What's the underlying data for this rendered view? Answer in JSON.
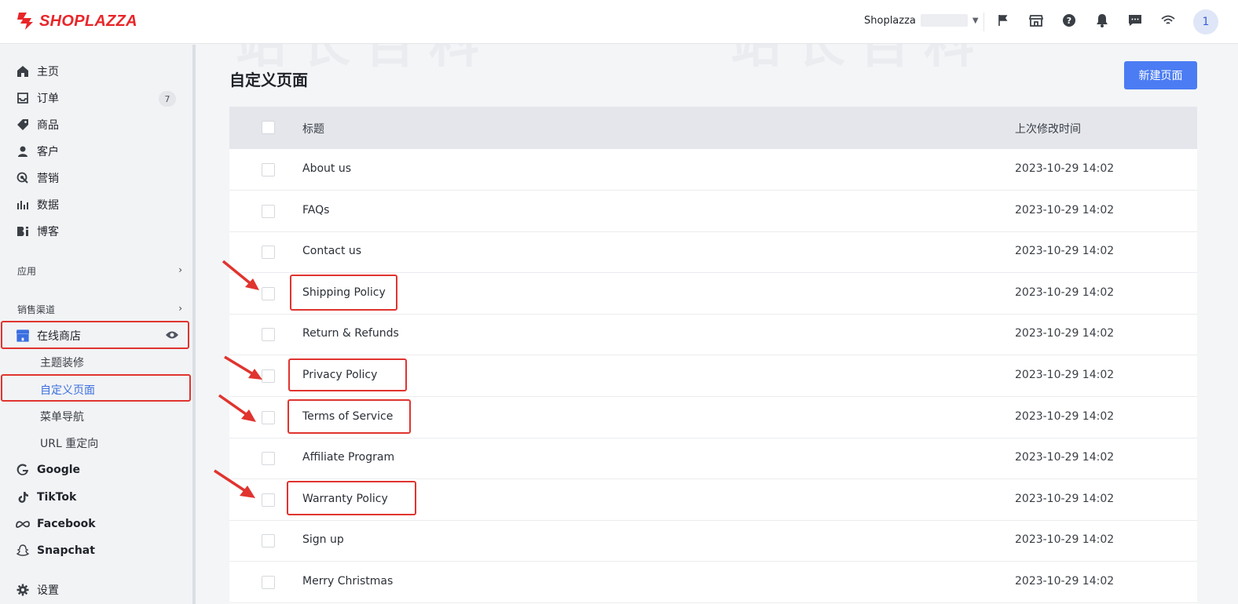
{
  "brand": {
    "name": "SHOPLAZZA",
    "color": "#e8262a"
  },
  "header": {
    "store_name": "Shoplazza",
    "avatar_initial": "1",
    "icons": [
      "flag-icon",
      "store-icon",
      "help-icon",
      "bell-icon",
      "message-icon",
      "wifi-icon"
    ]
  },
  "sidebar": {
    "items": [
      {
        "label": "主页",
        "icon": "home-icon"
      },
      {
        "label": "订单",
        "icon": "inbox-icon",
        "badge": "7"
      },
      {
        "label": "商品",
        "icon": "tag-icon"
      },
      {
        "label": "客户",
        "icon": "person-icon"
      },
      {
        "label": "营销",
        "icon": "marketing-icon"
      },
      {
        "label": "数据",
        "icon": "bar-chart-icon"
      },
      {
        "label": "博客",
        "icon": "blog-icon"
      }
    ],
    "apps_label": "应用",
    "channels_label": "销售渠道",
    "online_store": {
      "label": "在线商店",
      "icon": "store-icon"
    },
    "sub_items": [
      "主题装修",
      "自定义页面",
      "菜单导航",
      "URL 重定向"
    ],
    "channels": [
      {
        "label": "Google",
        "icon": "google-icon"
      },
      {
        "label": "TikTok",
        "icon": "tiktok-icon"
      },
      {
        "label": "Facebook",
        "icon": "meta-icon"
      },
      {
        "label": "Snapchat",
        "icon": "snapchat-icon"
      }
    ],
    "settings_label": "设置"
  },
  "main": {
    "title": "自定义页面",
    "new_button": "新建页面",
    "columns": {
      "title": "标题",
      "modified": "上次修改时间"
    },
    "rows": [
      {
        "title": "About us",
        "modified": "2023-10-29 14:02"
      },
      {
        "title": "FAQs",
        "modified": "2023-10-29 14:02"
      },
      {
        "title": "Contact us",
        "modified": "2023-10-29 14:02"
      },
      {
        "title": "Shipping Policy",
        "modified": "2023-10-29 14:02"
      },
      {
        "title": "Return & Refunds",
        "modified": "2023-10-29 14:02"
      },
      {
        "title": "Privacy Policy",
        "modified": "2023-10-29 14:02"
      },
      {
        "title": "Terms of Service",
        "modified": "2023-10-29 14:02"
      },
      {
        "title": "Affiliate Program",
        "modified": "2023-10-29 14:02"
      },
      {
        "title": "Warranty Policy",
        "modified": "2023-10-29 14:02"
      },
      {
        "title": "Sign up",
        "modified": "2023-10-29 14:02"
      },
      {
        "title": "Merry Christmas",
        "modified": "2023-10-29 14:02"
      }
    ]
  },
  "watermark": "站长百科",
  "colors": {
    "accent": "#4b7cf3",
    "annotation": "#e0342f",
    "active_link": "#3b6fe0"
  }
}
